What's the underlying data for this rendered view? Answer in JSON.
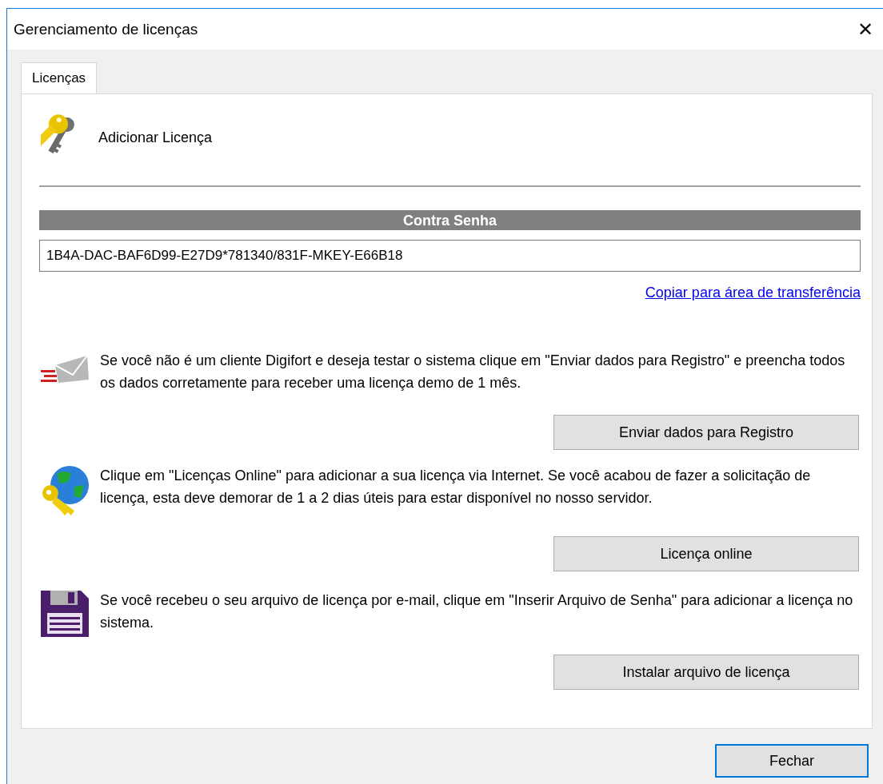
{
  "window": {
    "title": "Gerenciamento de licenças",
    "close_glyph": "✕"
  },
  "tabs": [
    {
      "label": "Licenças",
      "selected": true
    }
  ],
  "header": {
    "title": "Adicionar Licença"
  },
  "counter_password": {
    "heading": "Contra Senha",
    "value": "1B4A-DAC-BAF6D99-E27D9*781340/831F-MKEY-E66B18"
  },
  "copy_link": "Copiar para área de transferência",
  "sections": [
    {
      "kind": "mail",
      "text": "Se você não é um cliente Digifort e deseja testar o sistema clique em \"Enviar dados para Registro\" e preencha todos os dados corretamente para receber uma licença demo de 1 mês.",
      "button": "Enviar dados para Registro"
    },
    {
      "kind": "globe",
      "text": "Clique em \"Licenças Online\" para adicionar a sua licença via Internet. Se você acabou de fazer a solicitação de licença, esta deve demorar de 1 a 2 dias úteis para estar disponível no nosso servidor.",
      "button": "Licença online"
    },
    {
      "kind": "disk",
      "text": "Se você recebeu o seu arquivo de licença por e-mail, clique em \"Inserir Arquivo de Senha\" para adicionar a licença no sistema.",
      "button": "Instalar arquivo de licença"
    }
  ],
  "footer": {
    "button": "Fechar",
    "default": true
  }
}
